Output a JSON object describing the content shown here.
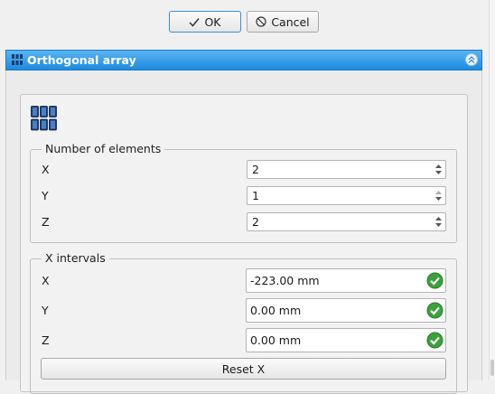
{
  "toolbar": {
    "ok_label": "OK",
    "cancel_label": "Cancel"
  },
  "panel": {
    "title": "Orthogonal array",
    "header_color": "#2b90e6"
  },
  "elements_group": {
    "title": "Number of elements",
    "rows": [
      {
        "label": "X",
        "value": "2"
      },
      {
        "label": "Y",
        "value": "1"
      },
      {
        "label": "Z",
        "value": "2"
      }
    ]
  },
  "intervals_group": {
    "title": "X intervals",
    "rows": [
      {
        "label": "X",
        "value": "-223.00 mm"
      },
      {
        "label": "Y",
        "value": "0.00 mm"
      },
      {
        "label": "Z",
        "value": "0.00 mm"
      }
    ],
    "reset_label": "Reset X"
  },
  "icons": {
    "ok": "checkmark-icon",
    "cancel": "cancel-circle-icon",
    "panel": "orthogonal-array-icon",
    "collapse": "collapse-up-icon",
    "valid": "valid-check-icon"
  },
  "colors": {
    "valid": "#3aa23a",
    "accent": "#3d8fd6"
  }
}
